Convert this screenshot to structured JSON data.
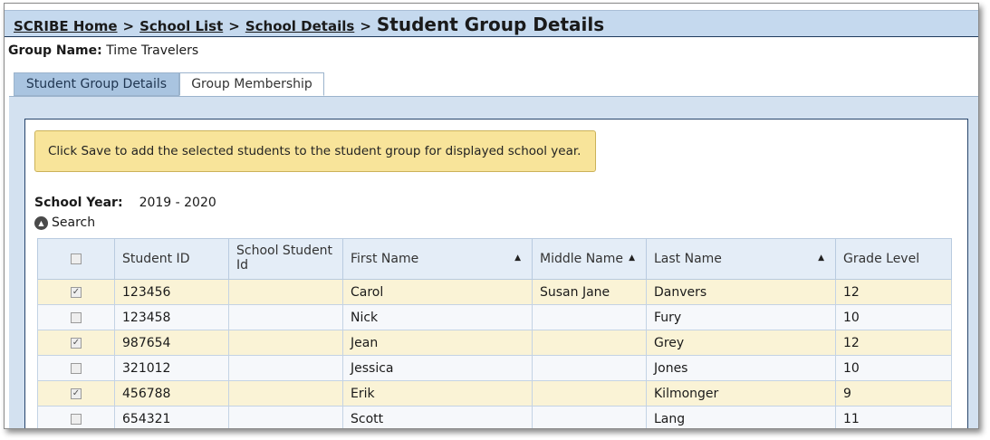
{
  "breadcrumb": {
    "items": [
      "SCRIBE Home",
      "School List",
      "School Details"
    ],
    "separator": ">",
    "current": "Student Group Details"
  },
  "group": {
    "label": "Group Name:",
    "value": "Time Travelers"
  },
  "tabs": [
    {
      "label": "Student Group Details",
      "active": false
    },
    {
      "label": "Group Membership",
      "active": true
    }
  ],
  "notice": "Click Save to add the selected students to the student group for displayed school year.",
  "school_year": {
    "label": "School Year:",
    "value": "2019 - 2020"
  },
  "search": {
    "label": "Search",
    "icon": "chevron-up-circle-icon"
  },
  "table": {
    "columns": [
      "Student ID",
      "School Student Id",
      "First Name",
      "Middle Name",
      "Last Name",
      "Grade Level"
    ],
    "sort_glyph": "▲",
    "rows": [
      {
        "checked": true,
        "id": "123456",
        "school_id": "",
        "first": "Carol",
        "middle": "Susan Jane",
        "last": "Danvers",
        "grade": "12"
      },
      {
        "checked": false,
        "id": "123458",
        "school_id": "",
        "first": "Nick",
        "middle": "",
        "last": "Fury",
        "grade": "10"
      },
      {
        "checked": true,
        "id": "987654",
        "school_id": "",
        "first": "Jean",
        "middle": "",
        "last": "Grey",
        "grade": "12"
      },
      {
        "checked": false,
        "id": "321012",
        "school_id": "",
        "first": "Jessica",
        "middle": "",
        "last": "Jones",
        "grade": "10"
      },
      {
        "checked": true,
        "id": "456788",
        "school_id": "",
        "first": "Erik",
        "middle": "",
        "last": "Kilmonger",
        "grade": "9"
      },
      {
        "checked": false,
        "id": "654321",
        "school_id": "",
        "first": "Scott",
        "middle": "",
        "last": "Lang",
        "grade": "11"
      }
    ]
  },
  "colors": {
    "titlebar": "#c5d9ee",
    "notice_bg": "#f8e49a",
    "selected_row": "#faf3d6",
    "header_bg": "#e4edf7"
  }
}
